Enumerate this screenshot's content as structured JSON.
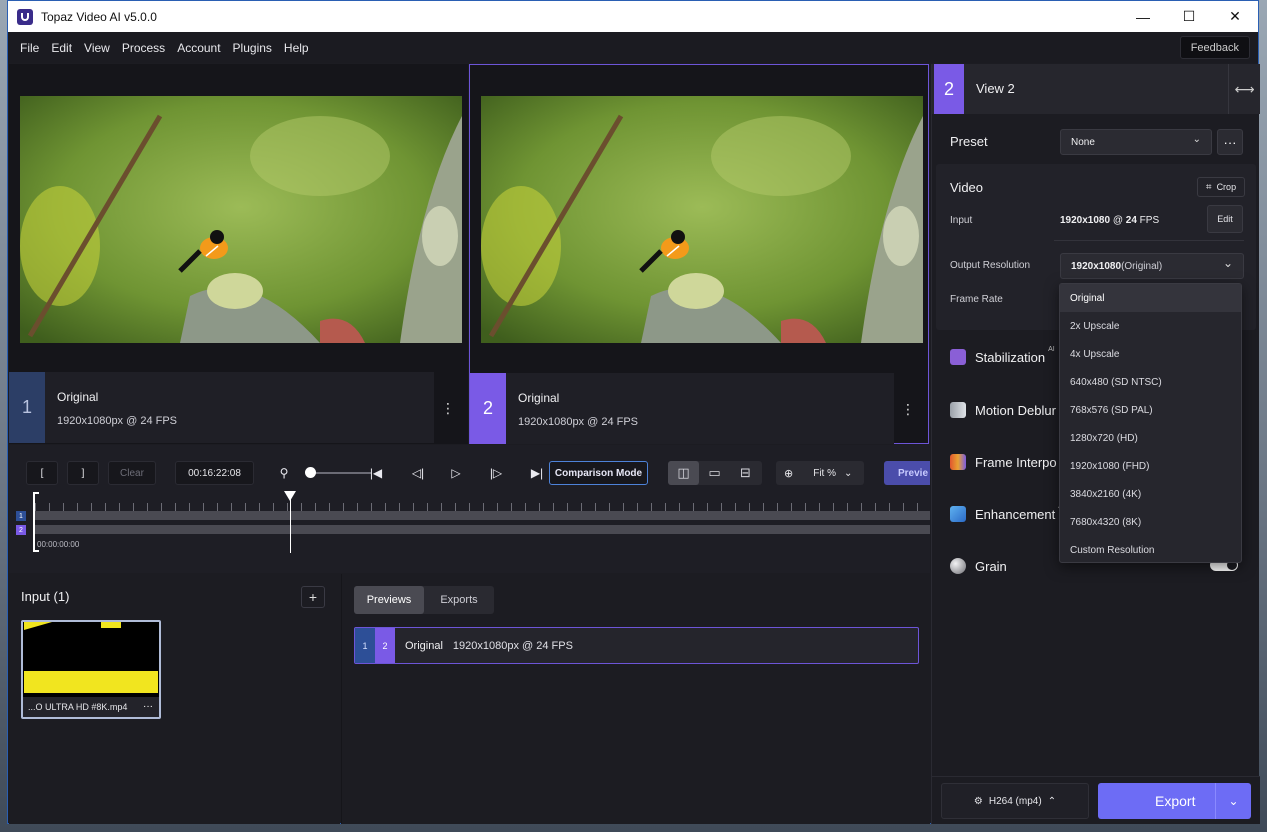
{
  "window": {
    "title": "Topaz Video AI  v5.0.0",
    "controls": [
      "—",
      "☐",
      "✕"
    ]
  },
  "menu": {
    "items": [
      "File",
      "Edit",
      "View",
      "Process",
      "Account",
      "Plugins",
      "Help"
    ],
    "feedback": "Feedback"
  },
  "panes": [
    {
      "number": "1",
      "title": "Original",
      "subtitle": "1920x1080px @ 24 FPS"
    },
    {
      "number": "2",
      "title": "Original",
      "subtitle": "1920x1080px @ 24 FPS"
    }
  ],
  "controls": {
    "mark_in": "[",
    "mark_out": "]",
    "clear": "Clear",
    "timecode": "00:16:22:08",
    "comparison_mode": "Comparison Mode",
    "zoom": "Fit %",
    "preview": "Previe",
    "timeline_start": "00:00:00:00",
    "track_labels": [
      "1",
      "2"
    ],
    "playhead_fraction": 0.285
  },
  "input": {
    "title": "Input (1)",
    "add": "+",
    "file_name": "...O ULTRA HD #8K.mp4",
    "file_more": "···"
  },
  "previews": {
    "tabs": [
      "Previews",
      "Exports"
    ],
    "active_tab": "Previews",
    "row": {
      "n1": "1",
      "n2": "2",
      "title": "Original",
      "subtitle": "1920x1080px @ 24 FPS"
    }
  },
  "right_panel": {
    "view_number": "2",
    "view_title": "View 2",
    "swap_icon": "⟷",
    "preset_label": "Preset",
    "preset_value": "None",
    "preset_more": "···",
    "video_label": "Video",
    "crop": "Crop",
    "input_label": "Input",
    "input_res": "1920x1080",
    "input_at": " @ ",
    "input_fps": "24",
    "input_fps_unit": " FPS",
    "edit": "Edit",
    "output_res_label": "Output Resolution",
    "output_res_bold": "1920x1080",
    "output_res_note": " (Original)",
    "frame_rate_label": "Frame Rate",
    "features": [
      {
        "label": "Stabilization",
        "ai": "AI",
        "color": "#8a5fd6"
      },
      {
        "label": "Motion Deblur",
        "ai": "",
        "color": "#9aa0a8"
      },
      {
        "label": "Frame Interpo",
        "ai": "",
        "color": "#e0562f"
      },
      {
        "label": "Enhancement",
        "ai": "A",
        "color": "#3e8fd8"
      },
      {
        "label": "Grain",
        "ai": "",
        "color": "#c8c8cc"
      }
    ],
    "codec": "H264 (mp4)",
    "export": "Export"
  },
  "dropdown": {
    "options": [
      "Original",
      "2x Upscale",
      "4x Upscale",
      "640x480 (SD NTSC)",
      "768x576 (SD PAL)",
      "1280x720 (HD)",
      "1920x1080 (FHD)",
      "3840x2160 (4K)",
      "7680x4320 (8K)",
      "Custom Resolution"
    ],
    "selected": "Original"
  },
  "colors": {
    "accent": "#7a5ae6",
    "export": "#6d6cf5",
    "view1": "#2d4f97"
  }
}
